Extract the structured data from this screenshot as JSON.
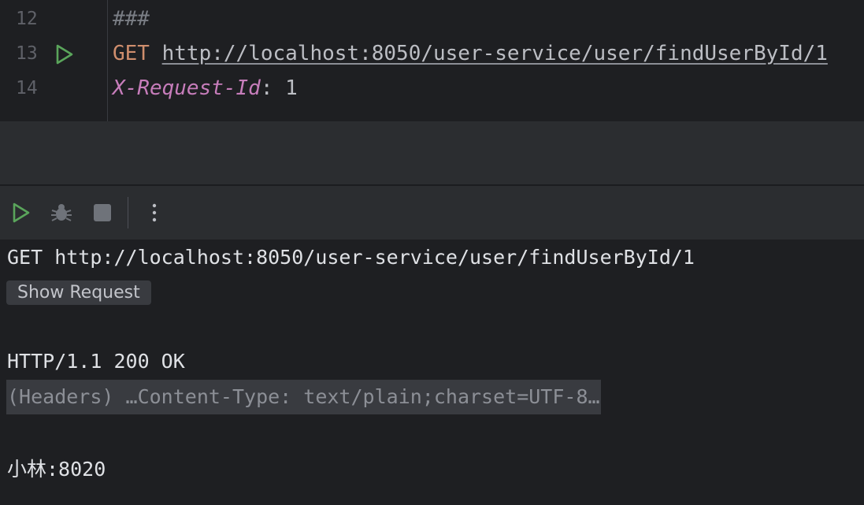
{
  "editor": {
    "lines": [
      {
        "number": "12",
        "text": "###"
      },
      {
        "number": "13",
        "method": "GET",
        "url": "http://localhost:8050/user-service/user/findUserById/1"
      },
      {
        "number": "14",
        "header_name": "X-Request-Id",
        "separator": ": ",
        "header_value": "1"
      }
    ],
    "run_icon": "run-request-icon"
  },
  "toolbar": {
    "icons": [
      "run-icon",
      "debug-icon",
      "stop-icon",
      "more-options-icon"
    ],
    "colors": {
      "run": "#5aa55b",
      "disabled": "#6f737a"
    }
  },
  "output": {
    "request_line": "GET http://localhost:8050/user-service/user/findUserById/1",
    "show_request_label": "Show Request",
    "status_line": "HTTP/1.1 200 OK",
    "headers_folded": "(Headers) …Content-Type: text/plain;charset=UTF-8…",
    "body": "小林:8020"
  }
}
